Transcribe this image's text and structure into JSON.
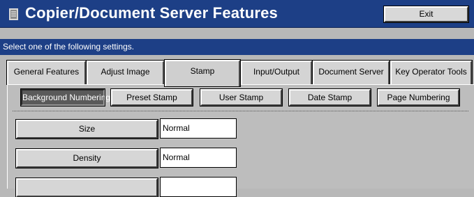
{
  "header": {
    "title": "Copier/Document Server Features",
    "icon": "document-icon",
    "exit_label": "Exit"
  },
  "instruction": "Select one of the following settings.",
  "tabs": [
    {
      "label": "General Features",
      "active": false
    },
    {
      "label": "Adjust Image",
      "active": false
    },
    {
      "label": "Stamp",
      "active": true
    },
    {
      "label": "Input/Output",
      "active": false
    },
    {
      "label": "Document Server",
      "active": false
    },
    {
      "label": "Key Operator Tools",
      "active": false
    }
  ],
  "stamp_types": [
    {
      "label": "Background Numbering",
      "selected": true
    },
    {
      "label": "Preset Stamp",
      "selected": false
    },
    {
      "label": "User Stamp",
      "selected": false
    },
    {
      "label": "Date Stamp",
      "selected": false
    },
    {
      "label": "Page Numbering",
      "selected": false
    }
  ],
  "settings": [
    {
      "label": "Size",
      "value": "Normal"
    },
    {
      "label": "Density",
      "value": "Normal"
    }
  ],
  "colors": {
    "title_bar": "#1d3f86",
    "background": "#b8b8b8",
    "selected_button": "#5a5a5a"
  }
}
